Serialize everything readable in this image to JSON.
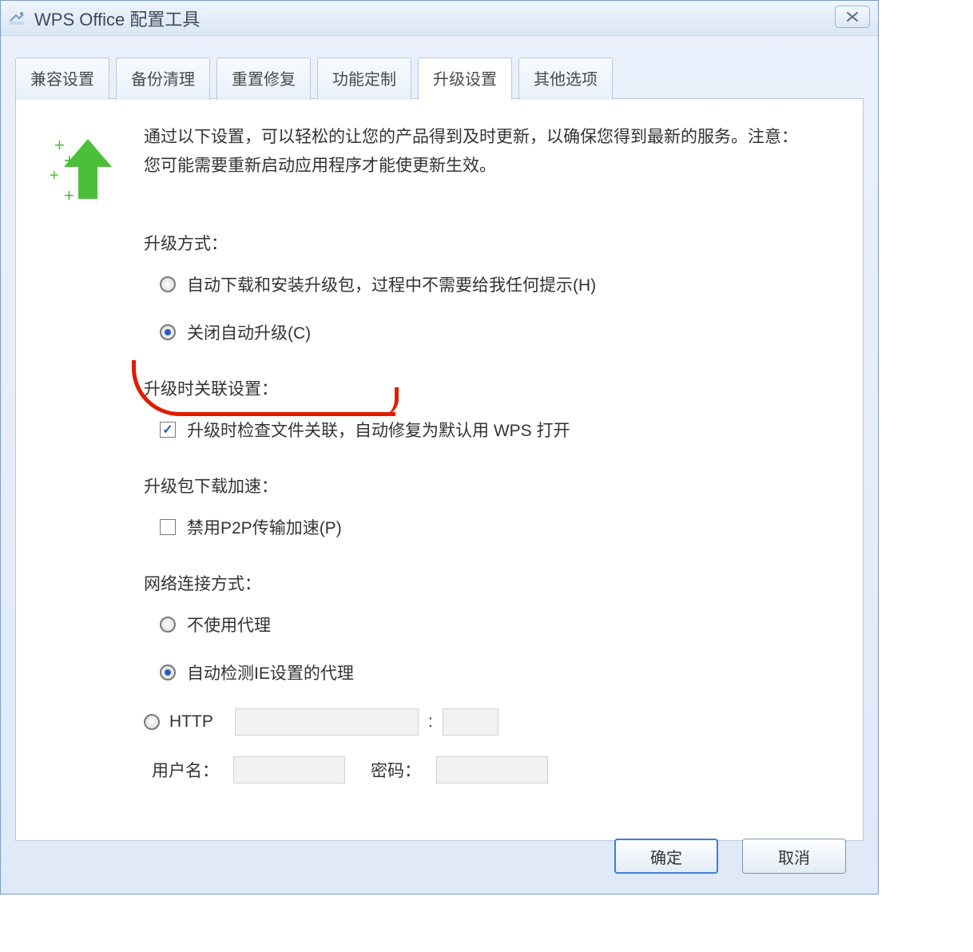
{
  "window": {
    "title": "WPS Office 配置工具",
    "close_label": "✕"
  },
  "tabs": [
    {
      "label": "兼容设置",
      "active": false
    },
    {
      "label": "备份清理",
      "active": false
    },
    {
      "label": "重置修复",
      "active": false
    },
    {
      "label": "功能定制",
      "active": false
    },
    {
      "label": "升级设置",
      "active": true
    },
    {
      "label": "其他选项",
      "active": false
    }
  ],
  "main": {
    "description": "通过以下设置，可以轻松的让您的产品得到及时更新，以确保您得到最新的服务。注意：您可能需要重新启动应用程序才能使更新生效。",
    "upgrade_mode": {
      "title": "升级方式：",
      "options": [
        {
          "label": "自动下载和安装升级包，过程中不需要给我任何提示(H)",
          "checked": false
        },
        {
          "label": "关闭自动升级(C)",
          "checked": true
        }
      ]
    },
    "assoc": {
      "title": "升级时关联设置：",
      "checkbox_label": "升级时检查文件关联，自动修复为默认用 WPS 打开",
      "checked": true
    },
    "accel": {
      "title": "升级包下载加速：",
      "checkbox_label": "禁用P2P传输加速(P)",
      "checked": false
    },
    "network": {
      "title": "网络连接方式：",
      "options": [
        {
          "label": "不使用代理",
          "checked": false
        },
        {
          "label": "自动检测IE设置的代理",
          "checked": true
        },
        {
          "label": "HTTP",
          "checked": false
        }
      ],
      "http_host": "",
      "http_port": "",
      "colon": ":",
      "username_label": "用户名：",
      "username": "",
      "password_label": "密码：",
      "password": ""
    }
  },
  "buttons": {
    "ok": "确定",
    "cancel": "取消"
  }
}
